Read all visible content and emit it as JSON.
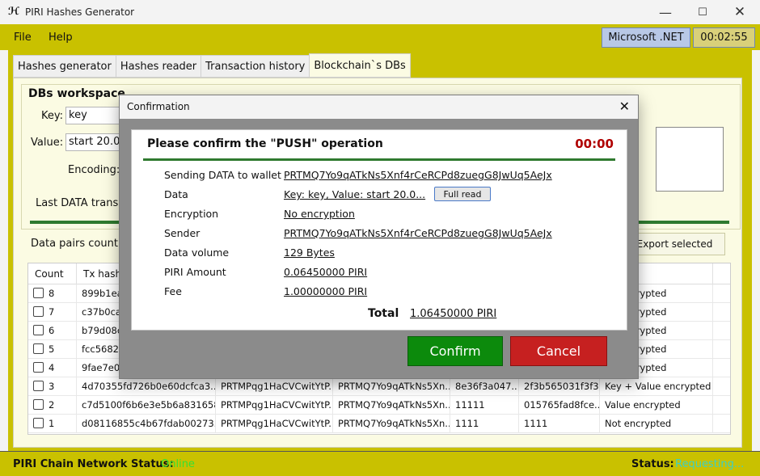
{
  "window": {
    "title": "PIRI Hashes Generator",
    "icon": "app-logo-icon"
  },
  "menu": {
    "file": "File",
    "help": "Help",
    "dotnet": "Microsoft .NET",
    "timer": "00:02:55"
  },
  "tabs": [
    "Hashes generator",
    "Hashes reader",
    "Transaction history",
    "Blockchain`s DBs"
  ],
  "workspace": {
    "title": "DBs workspace",
    "key_label": "Key:",
    "key_value": "key",
    "value_label": "Value:",
    "value_value": "start 20.09",
    "encoding_label": "Encoding:",
    "last_tx_label": "Last DATA transa",
    "pairs_label": "Data pairs count:",
    "export_label": "Export selected"
  },
  "table": {
    "headers": [
      "Count",
      "Tx hash"
    ],
    "rows": [
      {
        "count": "8",
        "tx": "899b1ea",
        "c3": "",
        "c4": "",
        "c5": "",
        "c6": "",
        "status": "ue encrypted"
      },
      {
        "count": "7",
        "tx": "c37b0ca",
        "c3": "",
        "c4": "",
        "c5": "",
        "c6": "",
        "status": "ue encrypted"
      },
      {
        "count": "6",
        "tx": "b79d08c",
        "c3": "",
        "c4": "",
        "c5": "",
        "c6": "",
        "status": "ue encrypted"
      },
      {
        "count": "5",
        "tx": "fcc5682c",
        "c3": "",
        "c4": "",
        "c5": "",
        "c6": "",
        "status": "ue encrypted"
      },
      {
        "count": "4",
        "tx": "9fae7e02",
        "c3": "",
        "c4": "",
        "c5": "",
        "c6": "",
        "status": "ue encrypted"
      },
      {
        "count": "3",
        "tx": "4d70355fd726b0e60dcfca3...",
        "c3": "PRTMPqg1HaCVCwitYtP...",
        "c4": "PRTMQ7Yo9qATkNs5Xn...",
        "c5": "8e36f3a047...",
        "c6": "2f3b565031f3f3...",
        "status": "Key + Value encrypted"
      },
      {
        "count": "2",
        "tx": "c7d5100f6b6e3e5b6a831658...",
        "c3": "PRTMPqg1HaCVCwitYtP...",
        "c4": "PRTMQ7Yo9qATkNs5Xn...",
        "c5": "11111",
        "c6": "015765fad8fce...",
        "status": "Value encrypted"
      },
      {
        "count": "1",
        "tx": "d08116855c4b67fdab00273...",
        "c3": "PRTMPqg1HaCVCwitYtP...",
        "c4": "PRTMQ7Yo9qATkNs5Xn...",
        "c5": "1111",
        "c6": "1111",
        "status": "Not encrypted"
      }
    ]
  },
  "status": {
    "network_label": "PIRI Chain Network Status:",
    "network_value": "Online",
    "status_label": "Status:",
    "status_value": "Requesting..."
  },
  "dialog": {
    "title": "Confirmation",
    "heading": "Please confirm the \"PUSH\" operation",
    "timer": "00:00",
    "fields": [
      {
        "label": "Sending DATA to wallet",
        "value": "PRTMQ7Yo9qATkNs5Xnf4rCeRCPd8zuegG8JwUq5AeJx"
      },
      {
        "label": "Data",
        "value": "Key: key, Value: start 20.0..."
      },
      {
        "label": "Encryption",
        "value": "No encryption"
      },
      {
        "label": "Sender",
        "value": "PRTMQ7Yo9qATkNs5Xnf4rCeRCPd8zuegG8JwUq5AeJx"
      },
      {
        "label": "Data volume",
        "value": "129 Bytes"
      },
      {
        "label": "PIRI Amount",
        "value": "0.06450000 PIRI"
      },
      {
        "label": "Fee",
        "value": "1.00000000 PIRI"
      }
    ],
    "full_read": "Full read",
    "total_label": "Total",
    "total_value": "1.06450000 PIRI",
    "confirm": "Confirm",
    "cancel": "Cancel"
  }
}
